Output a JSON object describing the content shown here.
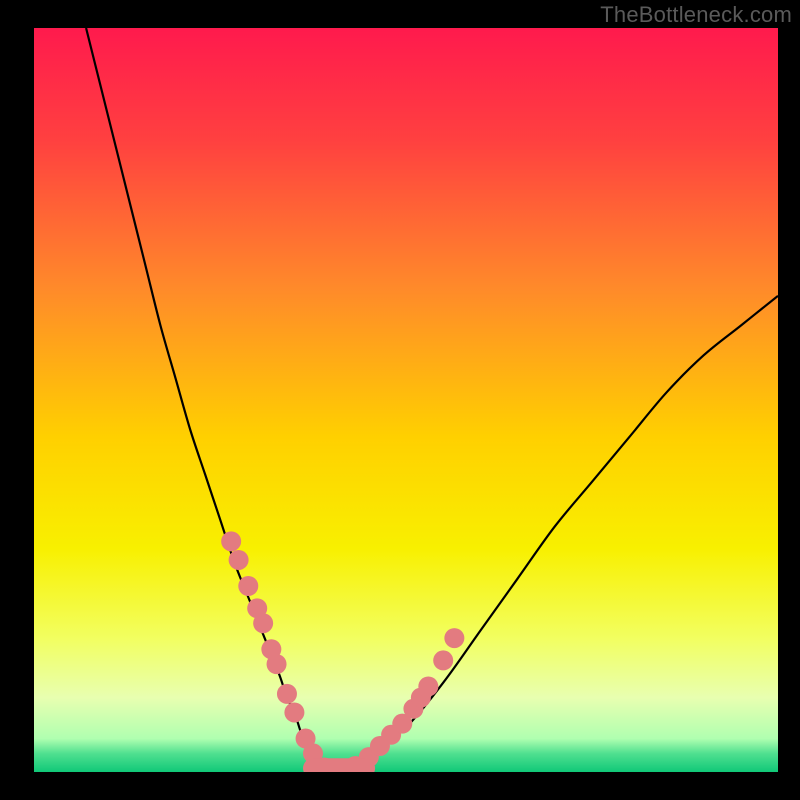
{
  "watermark": "TheBottleneck.com",
  "background_gradient": {
    "stops": [
      {
        "offset": 0.0,
        "color": "#ff1a4d"
      },
      {
        "offset": 0.15,
        "color": "#ff4040"
      },
      {
        "offset": 0.35,
        "color": "#ff8a2a"
      },
      {
        "offset": 0.55,
        "color": "#ffd000"
      },
      {
        "offset": 0.7,
        "color": "#f8f000"
      },
      {
        "offset": 0.82,
        "color": "#f2ff60"
      },
      {
        "offset": 0.9,
        "color": "#e8ffb0"
      },
      {
        "offset": 0.955,
        "color": "#b0ffb0"
      },
      {
        "offset": 0.975,
        "color": "#50e090"
      },
      {
        "offset": 1.0,
        "color": "#10c878"
      }
    ]
  },
  "chart_data": {
    "type": "line",
    "title": "",
    "xlabel": "",
    "ylabel": "",
    "xlim": [
      0,
      100
    ],
    "ylim": [
      0,
      100
    ],
    "series": [
      {
        "name": "bottleneck-curve",
        "x": [
          7,
          9,
          11,
          13,
          15,
          17,
          19,
          21,
          23,
          25,
          27,
          29,
          31,
          33,
          34,
          35,
          36,
          37,
          38,
          40,
          42,
          45,
          50,
          55,
          60,
          65,
          70,
          75,
          80,
          85,
          90,
          95,
          100
        ],
        "y": [
          100,
          92,
          84,
          76,
          68,
          60,
          53,
          46,
          40,
          34,
          28,
          23,
          18,
          13,
          10,
          8,
          5,
          3,
          2,
          0,
          0,
          2,
          6,
          12,
          19,
          26,
          33,
          39,
          45,
          51,
          56,
          60,
          64
        ]
      }
    ],
    "highlighted_points": {
      "name": "pink-dots",
      "color": "#e37b80",
      "x": [
        26.5,
        27.5,
        28.8,
        30.0,
        30.8,
        31.9,
        32.6,
        34.0,
        35.0,
        36.5,
        37.5,
        39.0,
        40.6,
        42.0,
        43.2,
        45.0,
        46.5,
        48.0,
        49.5,
        51.0,
        52.0,
        53.0,
        55.0,
        56.5
      ],
      "y": [
        31.0,
        28.5,
        25.0,
        22.0,
        20.0,
        16.5,
        14.5,
        10.5,
        8.0,
        4.5,
        2.5,
        0.6,
        0.0,
        0.0,
        0.8,
        2.0,
        3.5,
        5.0,
        6.5,
        8.5,
        10.0,
        11.5,
        15.0,
        18.0
      ]
    }
  }
}
